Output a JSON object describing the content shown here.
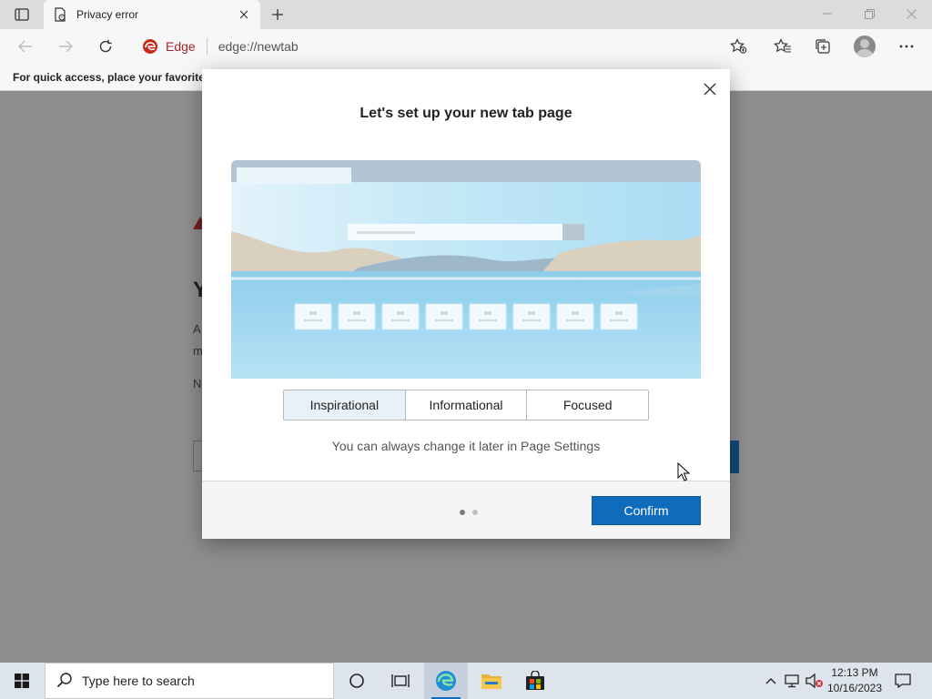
{
  "browser": {
    "tab_title": "Privacy error",
    "site_label": "Edge",
    "url": "edge://newtab",
    "favorites_hint": "For quick access, place your favorites h"
  },
  "background_page": {
    "heading_fragment": "Y",
    "line1_fragment": "A",
    "line2_fragment": "m",
    "line3_fragment": "N"
  },
  "modal": {
    "title": "Let's set up your new tab page",
    "layout_options": [
      {
        "label": "Inspirational",
        "selected": true
      },
      {
        "label": "Informational",
        "selected": false
      },
      {
        "label": "Focused",
        "selected": false
      }
    ],
    "helper_text": "You can always change it later in Page Settings",
    "confirm_label": "Confirm",
    "pager": {
      "current": 1,
      "total": 2
    }
  },
  "taskbar": {
    "search_placeholder": "Type here to search",
    "time": "12:13 PM",
    "date": "10/16/2023"
  },
  "colors": {
    "accent": "#0f6cbd",
    "edge_red": "#a4262c"
  }
}
